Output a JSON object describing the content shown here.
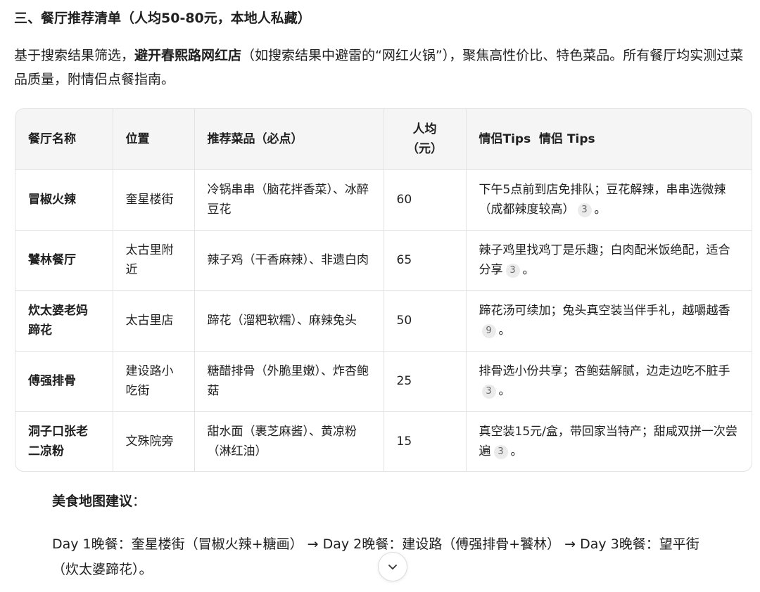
{
  "heading": "三、餐厅推荐清单（人均50-80元，本地人私藏）",
  "intro": {
    "pre": "基于搜索结果筛选，",
    "bold": "避开春熙路网红店",
    "post": "（如搜索结果中避雷的“网红火锅”），聚焦高性价比、特色菜品。所有餐厅均实测过菜品质量，附情侣点餐指南。"
  },
  "table": {
    "headers": [
      "餐厅名称",
      "位置",
      "推荐菜品（必点）",
      "人均\n（元）",
      "情侣Tips  情侣 Tips"
    ],
    "rows": [
      {
        "name": "冒椒火辣",
        "location": "奎星楼街",
        "dishes": "冷锅串串（脑花拌香菜）、冰醉豆花",
        "price": "60",
        "tips": "下午5点前到店免排队；豆花解辣，串串选微辣（成都辣度较高）",
        "cite": "3",
        "end": "。"
      },
      {
        "name": "饕林餐厅",
        "location": "太古里附近",
        "dishes": "辣子鸡（干香麻辣）、非遗白肉",
        "price": "65",
        "tips": "辣子鸡里找鸡丁是乐趣；白肉配米饭绝配，适合分享",
        "cite": "3",
        "end": "。"
      },
      {
        "name": "炊太婆老妈蹄花",
        "location": "太古里店",
        "dishes": "蹄花（溜粑软糯）、麻辣兔头",
        "price": "50",
        "tips": "蹄花汤可续加；兔头真空装当伴手礼，越嚼越香",
        "cite": "9",
        "end": "。"
      },
      {
        "name": "傅强排骨",
        "location": "建设路小吃街",
        "dishes": "糖醋排骨（外脆里嫩）、炸杏鲍菇",
        "price": "25",
        "tips": "排骨选小份共享；杏鲍菇解腻，边走边吃不脏手",
        "cite": "3",
        "end": "。"
      },
      {
        "name": "洞子口张老二凉粉",
        "location": "文殊院旁",
        "dishes": "甜水面（裹芝麻酱）、黄凉粉（淋红油）",
        "price": "15",
        "tips": "真空装15元/盒，带回家当特产；甜咸双拼一次尝遍",
        "cite": "3",
        "end": "。"
      }
    ]
  },
  "map_tip": {
    "bold": "美食地图建议",
    "colon": "："
  },
  "plan": "Day 1晚餐：奎星楼街（冒椒火辣+糖画） → Day 2晚餐：建设路（傅强排骨+饕林） → Day 3晚餐：望平街（炊太婆蹄花）。",
  "icons": {
    "scroll": "chevron-down-icon"
  }
}
